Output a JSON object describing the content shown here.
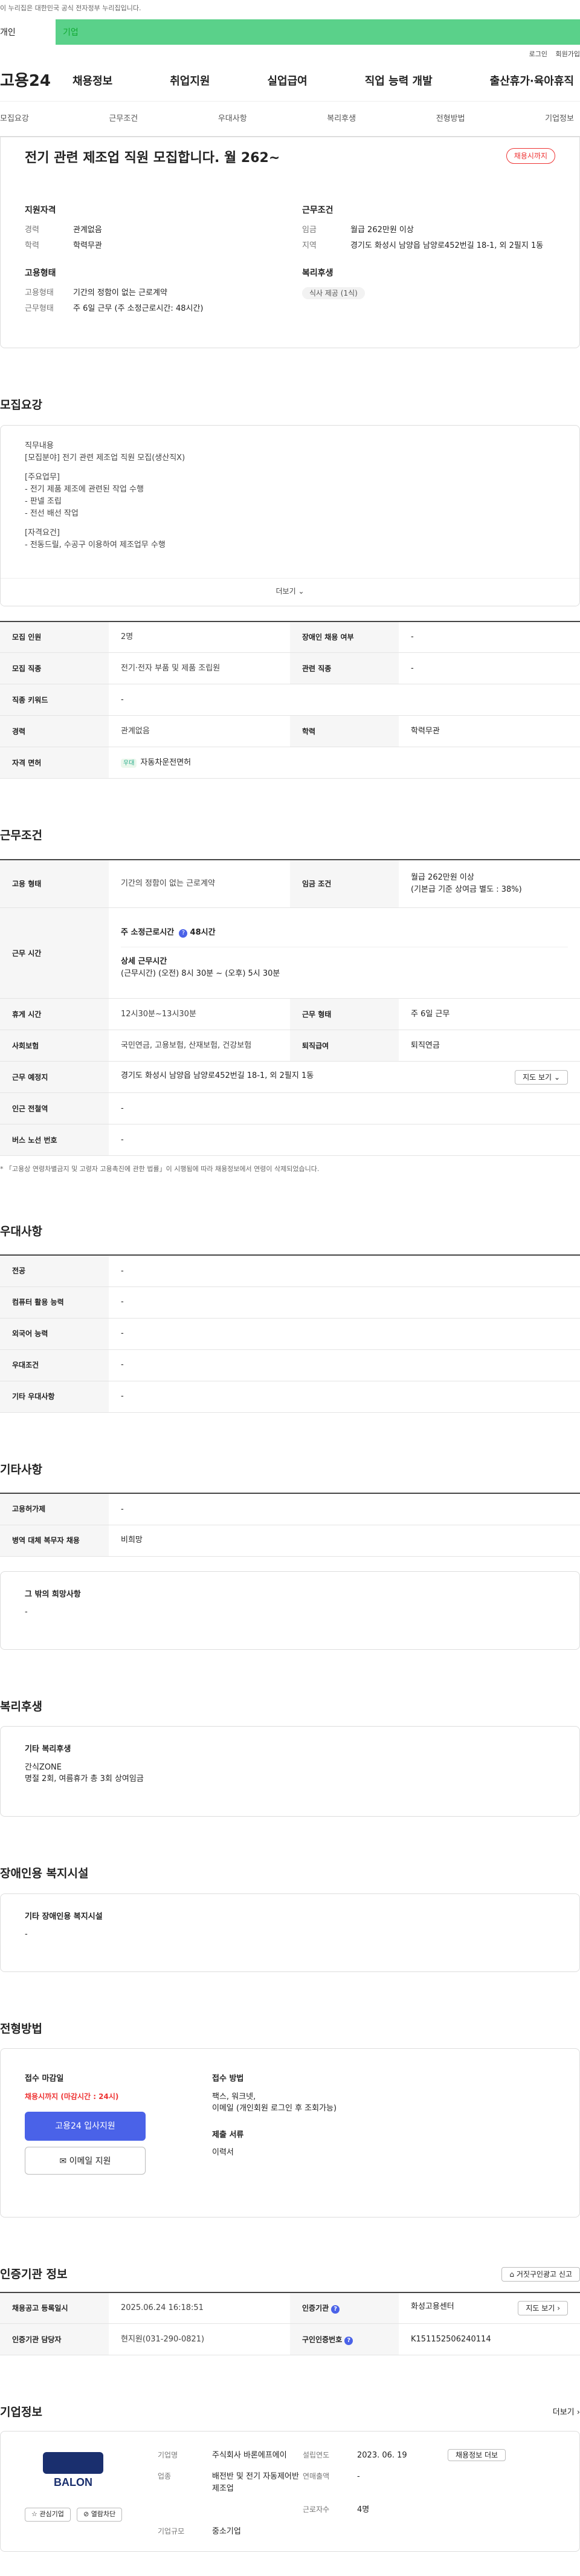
{
  "top": {
    "notice": "이 누리집은 대한민국 공식 전자정부 누리집입니다.",
    "tab_person": "개인",
    "tab_company": "기업"
  },
  "utility": {
    "login": "로그인",
    "join": "회원가입"
  },
  "gnb": {
    "logo": "고용24",
    "menu": [
      "채용정보",
      "취업지원",
      "실업급여",
      "직업 능력 개발",
      "출산휴가·육아휴직"
    ]
  },
  "subnav": [
    "모집요강",
    "근무조건",
    "우대사항",
    "복리후생",
    "전형방법",
    "기업정보"
  ],
  "summary": {
    "title": "전기 관련 제조업 직원 모집합니다. 월 262~",
    "badge": "채용시까지",
    "qual_title": "지원자격",
    "career_k": "경력",
    "career_v": "관계없음",
    "edu_k": "학력",
    "edu_v": "학력무관",
    "cond_title": "근무조건",
    "wage_k": "임금",
    "wage_v": "월급 262만원 이상",
    "region_k": "지역",
    "region_v": "경기도 화성시 남양읍 남양로452번길 18-1, 외 2필지 1동",
    "emp_title": "고용형태",
    "emp_k": "고용형태",
    "emp_v": "기간의 정함이 없는 근로계약",
    "worktype_k": "근무형태",
    "worktype_v": "주 6일 근무 (주 소정근로시간: 48시간)",
    "welfare_title": "복리후생",
    "welfare_chip": "식사 제공 (1식)"
  },
  "recruit": {
    "title": "모집요강",
    "desc_lines": [
      "직무내용",
      "[모집분야] 전기 관련 제조업 직원 모집(생산직X)",
      "",
      "[주요업무]",
      "- 전기 제품 제조에 관련된 작업 수행",
      "- 판넬 조립",
      "- 전선 배선 작업",
      "",
      "[자격요건]",
      "- 전동드릴, 수공구 이용하여 제조업무 수행"
    ],
    "more": "더보기",
    "rows": [
      {
        "k1": "모집 인원",
        "v1": "2명",
        "k2": "장애인 채용 여부",
        "v2": "-"
      },
      {
        "k1": "모집 직종",
        "v1": "전기·전자 부품 및 제품 조립원",
        "k2": "관련 직종",
        "v2": "-"
      },
      {
        "k1": "직종 키워드",
        "v1": "-"
      },
      {
        "k1": "경력",
        "v1": "관계없음",
        "k2": "학력",
        "v2": "학력무관"
      },
      {
        "k1": "자격 면허",
        "v1": "자동차운전면허",
        "tag": "우대"
      }
    ]
  },
  "work": {
    "title": "근무조건",
    "emp_k": "고용 형태",
    "emp_v": "기간의 정함이 없는 근로계약",
    "wage_k": "임금 조건",
    "wage_v": "월급 262만원 이상",
    "wage_sub": "(기본급 기준 상여금 별도 : 38%)",
    "time_k": "근무 시간",
    "time_week": "주 소정근로시간",
    "time_week_v": "48시간",
    "time_detail_t": "상세 근무시간",
    "time_detail": "(근무시간) (오전) 8시 30분 ~ (오후) 5시 30분",
    "rest_k": "휴게 시간",
    "rest_v": "12시30분~13시30분",
    "form_k": "근무 형태",
    "form_v": "주 6일 근무",
    "ins_k": "사회보험",
    "ins_v": "국민연금, 고용보험, 산재보험, 건강보험",
    "ret_k": "퇴직급여",
    "ret_v": "퇴직연금",
    "place_k": "근무 예정지",
    "place_v": "경기도 화성시 남양읍 남양로452번길 18-1, 외 2필지 1동",
    "map_btn": "지도 보기",
    "subway_k": "인근 전철역",
    "subway_v": "-",
    "bus_k": "버스 노선 번호",
    "bus_v": "-",
    "note": "* 「고용상 연령차별금지 및 고령자 고용촉진에 관한 법률」이 시행됨에 따라 채용정보에서 연령이 삭제되었습니다."
  },
  "pref": {
    "title": "우대사항",
    "rows": [
      [
        "전공",
        "-"
      ],
      [
        "컴퓨터 활용 능력",
        "-"
      ],
      [
        "외국어 능력",
        "-"
      ],
      [
        "우대조건",
        "-"
      ],
      [
        "기타 우대사항",
        "-"
      ]
    ]
  },
  "etc": {
    "title": "기타사항",
    "rows": [
      [
        "고용허가제",
        "-"
      ],
      [
        "병역 대체 복무자 채용",
        "비희망"
      ]
    ],
    "other_t": "그 밖의 희망사항",
    "other_v": "-"
  },
  "welfare": {
    "title": "복리후생",
    "box_t": "기타 복리후생",
    "line1": "간식ZONE",
    "line2": "명절 2회, 여름휴가 총 3회 상여임금"
  },
  "disabled": {
    "title": "장애인용 복지시설",
    "box_t": "기타 장애인용 복지시설",
    "box_v": "-"
  },
  "process": {
    "title": "전형방법",
    "deadline_t": "접수 마감일",
    "deadline_v": "채용시까지 (마감시간 : 24시)",
    "apply_btn": "고용24 입사지원",
    "email_btn": "이메일 지원",
    "method_t": "접수 방법",
    "method_v1": "팩스, 워크넷,",
    "method_v2": "이메일 (개인회원 로그인 후 조회가능)",
    "docs_t": "제출 서류",
    "docs_v": "이력서"
  },
  "cert": {
    "title": "인증기관 정보",
    "report_btn": "거짓구인광고 신고",
    "reg_k": "채용공고 등록일시",
    "reg_v": "2025.06.24 16:18:51",
    "org_k": "인증기관",
    "org_v": "화성고용센터",
    "map_btn": "지도 보기",
    "mgr_k": "인증기관 담당자",
    "mgr_v": "현지원(031-290-0821)",
    "id_k": "구인인증번호",
    "id_v": "K151152506240114"
  },
  "company": {
    "title": "기업정보",
    "more": "더보기",
    "logo_text": "BALON",
    "interest_btn": "관심기업",
    "block_btn": "열람차단",
    "name_k": "기업명",
    "name_v": "주식회사 바론에프에이",
    "found_k": "설립연도",
    "found_v": "2023. 06. 19",
    "other_btn": "채용정보 더보",
    "ind_k": "업종",
    "ind_v": "배전반 및 전기 자동제어반 제조업",
    "sales_k": "연매출액",
    "sales_v": "-",
    "emp_k": "근로자수",
    "emp_v": "4명",
    "size_k": "기업규모",
    "size_v": "중소기업"
  }
}
